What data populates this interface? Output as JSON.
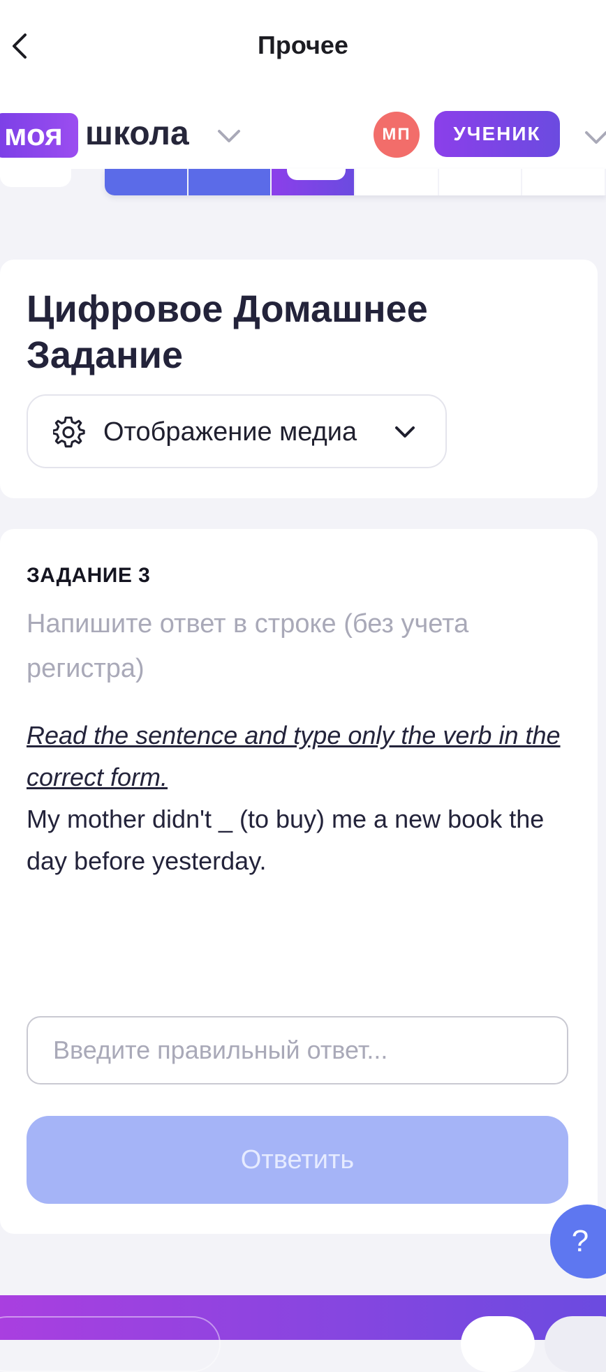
{
  "navbar": {
    "title": "Прочее"
  },
  "header": {
    "logo_part1": "моя",
    "logo_part2": "школа",
    "avatar_initials": "МП",
    "role": "УЧЕНИК"
  },
  "progress_tabs": {
    "total_visible": 6,
    "completed": 2,
    "current_index": 2
  },
  "title_card": {
    "title": "Цифровое Домашнее Задание",
    "media_select_label": "Отображение медиа"
  },
  "task": {
    "number_label": "ЗАДАНИЕ 3",
    "hint": "Напишите ответ в строке (без учета регистра)",
    "instruction": "Read the sentence and type only the verb in the correct form.",
    "sentence": "My mother didn't _ (to buy) me a new book the day before yesterday.",
    "input_value": "",
    "input_placeholder": "Введите правильный ответ...",
    "submit_label": "Ответить"
  },
  "help": {
    "label": "?"
  },
  "colors": {
    "accent_purple": "#8B3FEA",
    "accent_blue": "#5B6BE8",
    "avatar_red": "#F26D6A",
    "submit_disabled": "#A5B4F7"
  },
  "icons": {
    "back": "chevron-left-icon",
    "school_dropdown": "chevron-down-icon",
    "role_dropdown": "chevron-down-icon",
    "media_settings": "gear-icon",
    "media_dropdown": "chevron-down-icon"
  }
}
